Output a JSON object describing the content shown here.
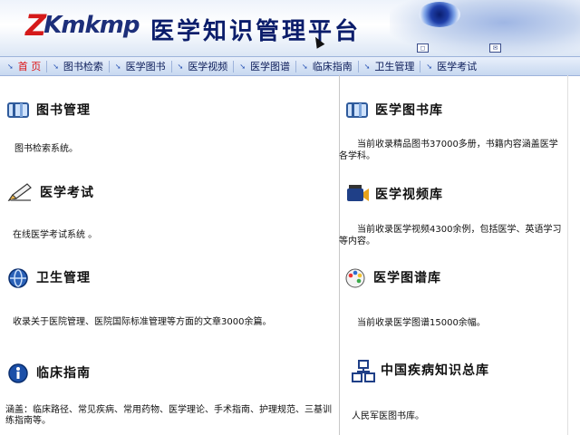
{
  "header": {
    "logo_z": "Z",
    "logo_rest": "Kmkmp",
    "title": "医学知识管理平台"
  },
  "nav": [
    {
      "label": "首  页",
      "active": true
    },
    {
      "label": "图书检索"
    },
    {
      "label": "医学图书"
    },
    {
      "label": "医学视频"
    },
    {
      "label": "医学图谱"
    },
    {
      "label": "临床指南"
    },
    {
      "label": "卫生管理"
    },
    {
      "label": "医学考试"
    }
  ],
  "left": [
    {
      "title": "图书管理",
      "desc": "图书检索系统。",
      "icon": "book-icon"
    },
    {
      "title": "医学考试",
      "desc": "在线医学考试系统 。",
      "icon": "pen-icon"
    },
    {
      "title": "卫生管理",
      "desc": "收录关于医院管理、医院国际标准管理等方面的文章3000余篇。",
      "icon": "globe-icon"
    },
    {
      "title": "临床指南",
      "desc": "涵盖：临床路径、常见疾病、常用药物、医学理论、手术指南、护理规范、三基训练指南等。",
      "icon": "info-circle-icon"
    }
  ],
  "right": [
    {
      "title": "医学图书库",
      "desc": "当前收录精品图书37000多册，书籍内容涵盖医学各学科。",
      "icon": "library-icon"
    },
    {
      "title": "医学视频库",
      "desc": "当前收录医学视频4300余例，包括医学、英语学习等内容。",
      "icon": "video-icon"
    },
    {
      "title": "医学图谱库",
      "desc": "当前收录医学图谱15000余幅。",
      "icon": "palette-icon"
    },
    {
      "title": "中国疾病知识总库",
      "desc": "人民军医图书库。",
      "icon": "database-icon"
    }
  ],
  "colors": {
    "nav_active": "#dd1111",
    "title_blue": "#0b1d6b"
  }
}
